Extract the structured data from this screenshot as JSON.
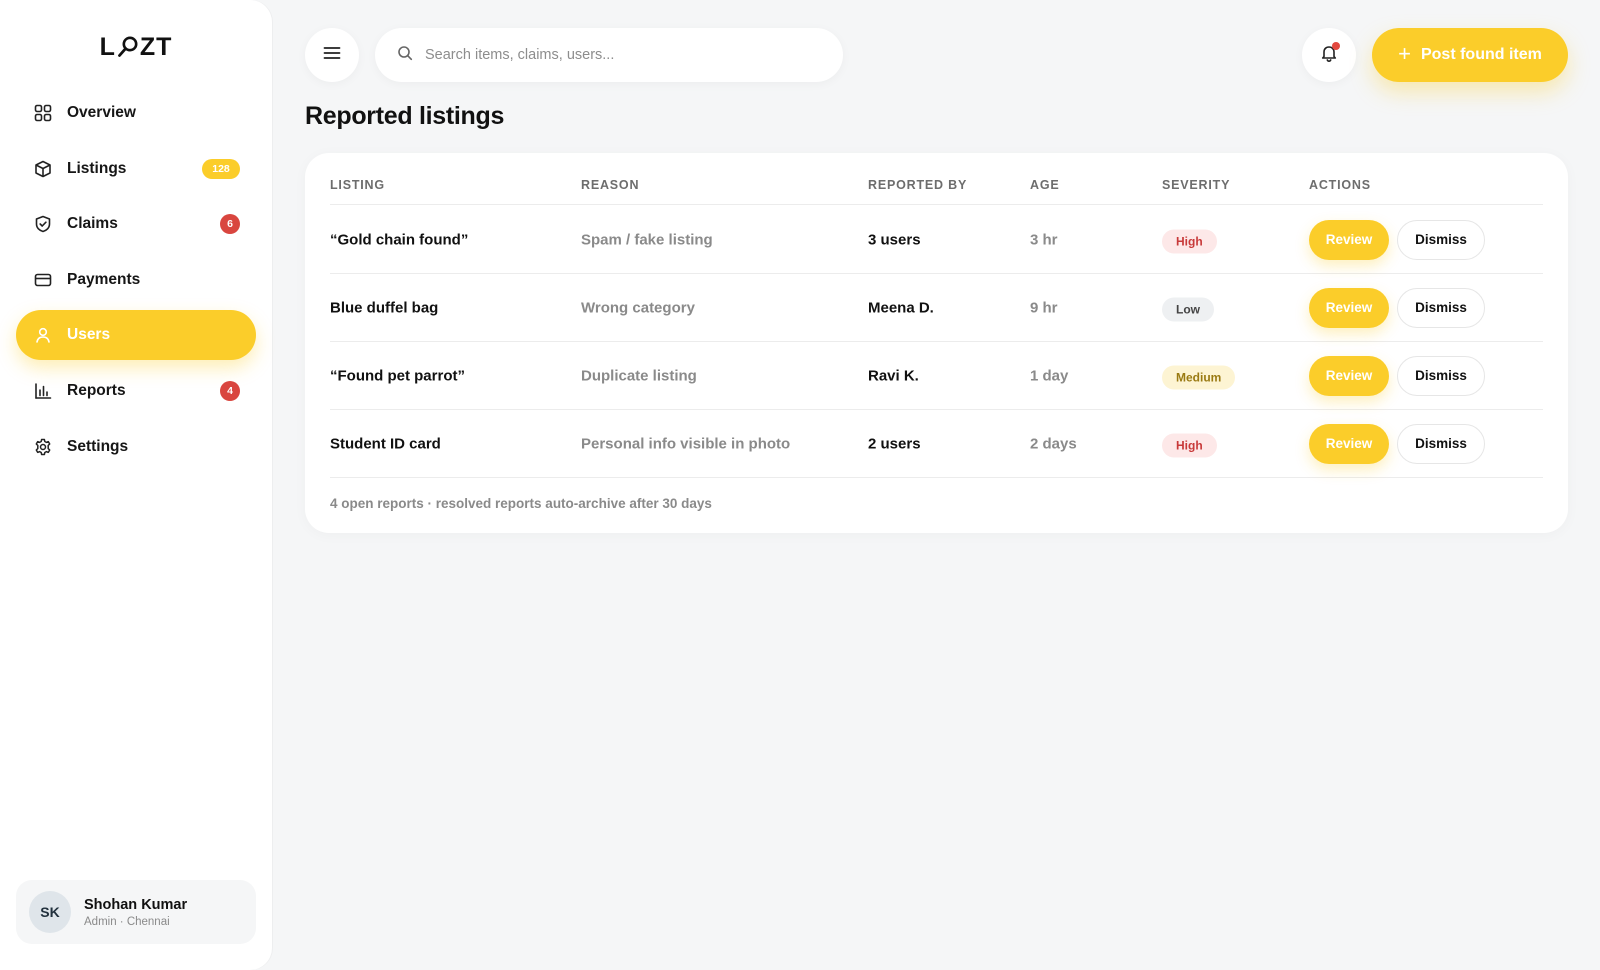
{
  "app": {
    "logo_left": "L",
    "logo_right": "ZT"
  },
  "sidebar": {
    "items": [
      {
        "label": "Overview",
        "icon": "grid-icon",
        "badge": ""
      },
      {
        "label": "Listings",
        "icon": "box-icon",
        "badge": "128",
        "badge_color": "#fbcd2a"
      },
      {
        "label": "Claims",
        "icon": "shield-check-icon",
        "badge": "6",
        "badge_color": "#d9463f"
      },
      {
        "label": "Payments",
        "icon": "credit-card-icon",
        "badge": ""
      },
      {
        "label": "Users",
        "icon": "user-icon",
        "badge": "",
        "active": true
      },
      {
        "label": "Reports",
        "icon": "bar-chart-icon",
        "badge": "4",
        "badge_color": "#d9463f"
      },
      {
        "label": "Settings",
        "icon": "gear-icon",
        "badge": ""
      }
    ],
    "user": {
      "initials": "SK",
      "name": "Shohan Kumar",
      "subtitle": "Admin · Chennai"
    }
  },
  "header": {
    "search_placeholder": "Search items, claims, users...",
    "post_button_label": "Post found item",
    "notification_dot": true
  },
  "main": {
    "title": "Reported listings",
    "table": {
      "columns": [
        "LISTING",
        "REASON",
        "REPORTED BY",
        "AGE",
        "SEVERITY",
        "ACTIONS"
      ],
      "rows": [
        {
          "listing": "“Gold chain found”",
          "reason": "Spam / fake listing",
          "reported_by": "3 users",
          "age": "3 hr",
          "severity": "High"
        },
        {
          "listing": "Blue duffel bag",
          "reason": "Wrong category",
          "reported_by": "Meena D.",
          "age": "9 hr",
          "severity": "Low"
        },
        {
          "listing": "“Found pet parrot”",
          "reason": "Duplicate listing",
          "reported_by": "Ravi K.",
          "age": "1 day",
          "severity": "Medium"
        },
        {
          "listing": "Student ID card",
          "reason": "Personal info visible in photo",
          "reported_by": "2 users",
          "age": "2 days",
          "severity": "High"
        }
      ],
      "review_label": "Review",
      "dismiss_label": "Dismiss",
      "footnote": "4 open reports · resolved reports auto-archive after 30 days"
    }
  },
  "colors": {
    "accent": "#fbcd2a",
    "danger": "#d9463f",
    "severity": {
      "High": {
        "bg": "#fde8e8",
        "fg": "#c83a3a"
      },
      "Low": {
        "bg": "#eef0f2",
        "fg": "#444444"
      },
      "Medium": {
        "bg": "#fdf4d3",
        "fg": "#9a7a12"
      }
    }
  }
}
